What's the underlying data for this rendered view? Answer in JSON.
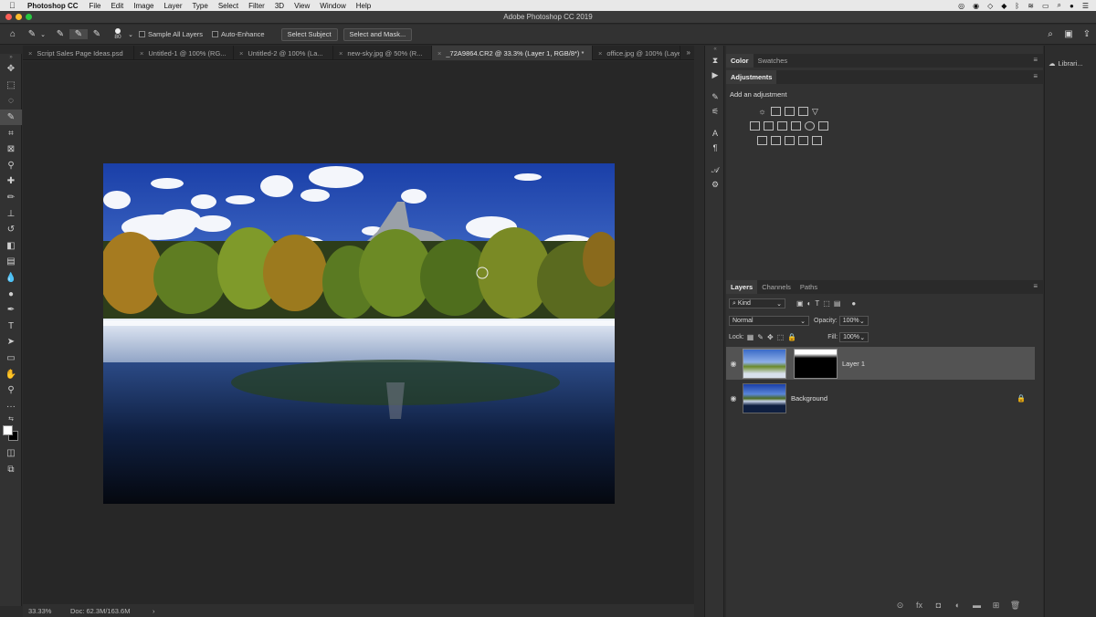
{
  "menubar": {
    "app_name": "Photoshop CC",
    "items": [
      "File",
      "Edit",
      "Image",
      "Layer",
      "Type",
      "Select",
      "Filter",
      "3D",
      "View",
      "Window",
      "Help"
    ]
  },
  "titlebar": {
    "title": "Adobe Photoshop CC 2019"
  },
  "options": {
    "brush_size": "80",
    "sample_all_layers": "Sample All Layers",
    "auto_enhance": "Auto-Enhance",
    "select_subject": "Select Subject",
    "select_and_mask": "Select and Mask..."
  },
  "tabs": [
    {
      "label": "Script Sales Page Ideas.psd",
      "active": false
    },
    {
      "label": "Untitled-1 @ 100% (RG...",
      "active": false
    },
    {
      "label": "Untitled-2 @ 100% (La...",
      "active": false
    },
    {
      "label": "new-sky.jpg @ 50% (R...",
      "active": false
    },
    {
      "label": "_72A9864.CR2 @ 33.3% (Layer 1, RGB/8*) *",
      "active": true
    },
    {
      "label": "office.jpg @ 100% (Laye...",
      "active": false
    }
  ],
  "status": {
    "zoom": "33.33%",
    "doc": "Doc: 62.3M/163.6M",
    "arrow": "›"
  },
  "color_panel": {
    "tabs": [
      "Color",
      "Swatches"
    ]
  },
  "adjustments_panel": {
    "tab": "Adjustments",
    "hint": "Add an adjustment"
  },
  "layers_panel": {
    "tabs": [
      "Layers",
      "Channels",
      "Paths"
    ],
    "filter_kind": "Kind",
    "blend_mode": "Normal",
    "opacity_label": "Opacity:",
    "opacity_value": "100%",
    "lock_label": "Lock:",
    "fill_label": "Fill:",
    "fill_value": "100%",
    "layers": [
      {
        "name": "Layer 1",
        "selected": true
      },
      {
        "name": "Background",
        "selected": false
      }
    ]
  },
  "right_dock": {
    "libraries": "Librari..."
  },
  "colors": {
    "accent": "#5a5a5a",
    "bg": "#2b2b2b"
  }
}
